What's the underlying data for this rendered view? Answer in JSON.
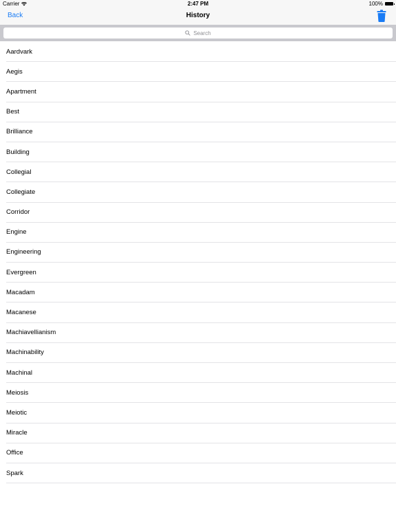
{
  "status_bar": {
    "carrier": "Carrier",
    "time": "2:47 PM",
    "battery": "100%"
  },
  "nav_bar": {
    "back_label": "Back",
    "title": "History",
    "delete_icon": "trash-icon",
    "accent_color": "#1a7cf5"
  },
  "search": {
    "placeholder": "Search",
    "icon": "search-icon"
  },
  "history": {
    "items": [
      "Aardvark",
      "Aegis",
      "Apartment",
      "Best",
      "Brilliance",
      "Building",
      "Collegial",
      "Collegiate",
      "Corridor",
      "Engine",
      "Engineering",
      "Evergreen",
      "Macadam",
      "Macanese",
      "Machiavellianism",
      "Machinability",
      "Machinal",
      "Meiosis",
      "Meiotic",
      "Miracle",
      "Office",
      "Spark"
    ]
  }
}
